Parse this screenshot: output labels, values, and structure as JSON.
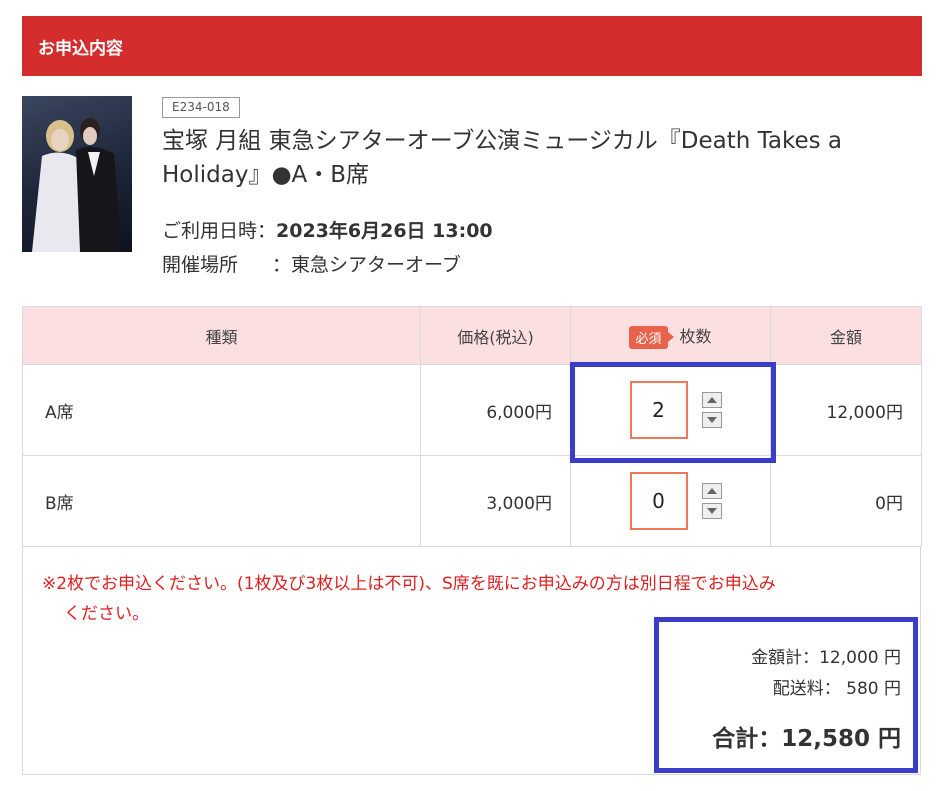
{
  "header": {
    "title": "お申込内容"
  },
  "event": {
    "code": "E234-018",
    "title": "宝塚 月組 東急シアターオーブ公演ミュージカル『Death Takes a Holiday』●A・B席",
    "date_label": "ご利用日時：",
    "date_value": "2023年6月26日  13:00",
    "venue_label": "開催場所",
    "venue_value": "：東急シアターオーブ"
  },
  "table": {
    "headers": {
      "type": "種類",
      "price": "価格(税込)",
      "required": "必須",
      "quantity": "枚数",
      "amount": "金額"
    },
    "rows": [
      {
        "type": "A席",
        "price": "6,000円",
        "quantity": "2",
        "amount": "12,000円"
      },
      {
        "type": "B席",
        "price": "3,000円",
        "quantity": "0",
        "amount": "0円"
      }
    ]
  },
  "notice": {
    "line1": "※2枚でお申込ください。(1枚及び3枚以上は不可)、S席を既にお申込みの方は別日程でお申込み",
    "line2": "ください。"
  },
  "totals": {
    "subtotal": "金額計：12,000 円",
    "shipping": "配送料：    580 円",
    "grand": "合計：12,580 円"
  },
  "colors": {
    "header_bg": "#d42d2d",
    "table_header_bg": "#fce0e1",
    "required_badge": "#e8624c",
    "notice_text": "#e02020",
    "highlight_border": "#3a3dc9"
  }
}
